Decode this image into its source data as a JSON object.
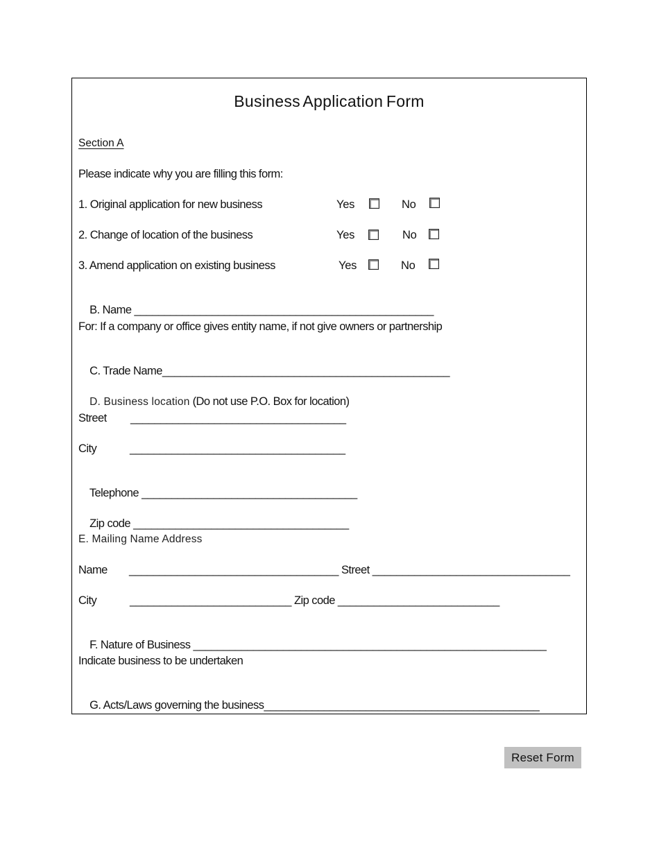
{
  "form": {
    "title": "Business Application Form",
    "section_a_label": "Section A",
    "intro": "Please indicate why you are filling this form:",
    "yes_label": "Yes",
    "no_label": "No",
    "questions": [
      {
        "label": "1. Original application for new business",
        "yes_checked": false,
        "no_checked": false
      },
      {
        "label": "2. Change of location of the business",
        "yes_checked": false,
        "no_checked": false
      },
      {
        "label": "3. Amend application on existing business",
        "yes_checked": false,
        "no_checked": false
      }
    ],
    "name_b": {
      "label": "B. Name ",
      "blank": "__________________________________________________"
    },
    "name_b_note": "For: If a company or office gives entity name, if not give owners or partnership",
    "trade_name": {
      "label": "C. Trade Name",
      "blank": "________________________________________________"
    },
    "section_d": {
      "heading": "D. Business location",
      "note": " (Do not use P.O. Box for location)",
      "street": {
        "label": "Street",
        "blank": "____________________________________"
      },
      "city": {
        "label": "City",
        "blank": "____________________________________"
      },
      "telephone": {
        "label": "Telephone ",
        "blank": "____________________________________"
      },
      "zip": {
        "label": "Zip code ",
        "blank": "____________________________________"
      }
    },
    "section_e": {
      "heading": "E. Mailing Name Address",
      "name": {
        "label": "Name",
        "blank": "___________________________________"
      },
      "street": {
        "label": " Street ",
        "blank": "_________________________________"
      },
      "city": {
        "label": "City",
        "blank": "___________________________"
      },
      "zip": {
        "label": " Zip code ",
        "blank": "___________________________"
      }
    },
    "nature": {
      "label": "F. Nature of Business ",
      "blank": "___________________________________________________________"
    },
    "nature_note": "Indicate business to be undertaken",
    "acts": {
      "label": "G. Acts/Laws governing the business",
      "blank": "______________________________________________"
    }
  },
  "actions": {
    "reset_label": "Reset Form"
  }
}
